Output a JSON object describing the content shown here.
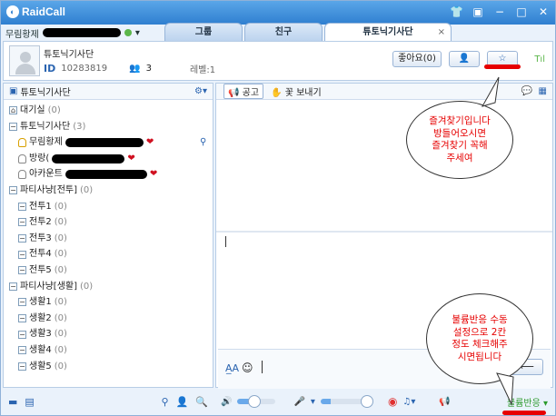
{
  "app": {
    "logo_text": "RaidCall"
  },
  "titlebar": {
    "icons": [
      "shirt-icon",
      "minimize-to-tray-icon",
      "minimize-icon",
      "maximize-icon",
      "close-icon"
    ]
  },
  "user": {
    "name": "무림황제"
  },
  "tabs": [
    {
      "label": "그룹"
    },
    {
      "label": "친구"
    },
    {
      "label": "튜토닉기사단",
      "close": "×"
    }
  ],
  "channel": {
    "name": "튜토닉기사단",
    "id_label": "ID",
    "id_value": "10283819",
    "members": "3",
    "level": "레벨:1",
    "like_button": "좋아요(0)",
    "signal": "Tıl"
  },
  "sidebar": {
    "title": "튜토닉기사단",
    "tree": [
      {
        "box": "⌂",
        "label": "대기실",
        "count": "(0)"
      },
      {
        "box": "−",
        "label": "튜토닉기사단",
        "count": "(3)"
      },
      {
        "label": "무림황제"
      },
      {
        "label": "방랑("
      },
      {
        "label": "아카운트"
      },
      {
        "box": "−",
        "label": "파티사냥[전투]",
        "count": "(0)"
      },
      {
        "box": "−",
        "label": "전투1",
        "count": "(0)"
      },
      {
        "box": "−",
        "label": "전투2",
        "count": "(0)"
      },
      {
        "box": "−",
        "label": "전투3",
        "count": "(0)"
      },
      {
        "box": "−",
        "label": "전투4",
        "count": "(0)"
      },
      {
        "box": "−",
        "label": "전투5",
        "count": "(0)"
      },
      {
        "box": "−",
        "label": "파티사냥[생활]",
        "count": "(0)"
      },
      {
        "box": "−",
        "label": "생활1",
        "count": "(0)"
      },
      {
        "box": "−",
        "label": "생활2",
        "count": "(0)"
      },
      {
        "box": "−",
        "label": "생활3",
        "count": "(0)"
      },
      {
        "box": "−",
        "label": "생활4",
        "count": "(0)"
      },
      {
        "box": "−",
        "label": "생활5",
        "count": "(0)"
      }
    ]
  },
  "toolbar": {
    "notice": "공고",
    "send_flowers": "꽃 보내기"
  },
  "input": {
    "send": "⟵"
  },
  "bottom": {
    "mode": "불륨반응"
  },
  "annotations": {
    "favorite": "즐겨찾기입니다\n방들어오시면\n즐겨찾기 꼭해\n주세여",
    "voice": "불륨반응 수동\n설정으로 2칸\n정도 체크해주\n시면됩니다"
  },
  "colors": {
    "accent": "#2f7fd0",
    "annotation": "#e60000"
  }
}
